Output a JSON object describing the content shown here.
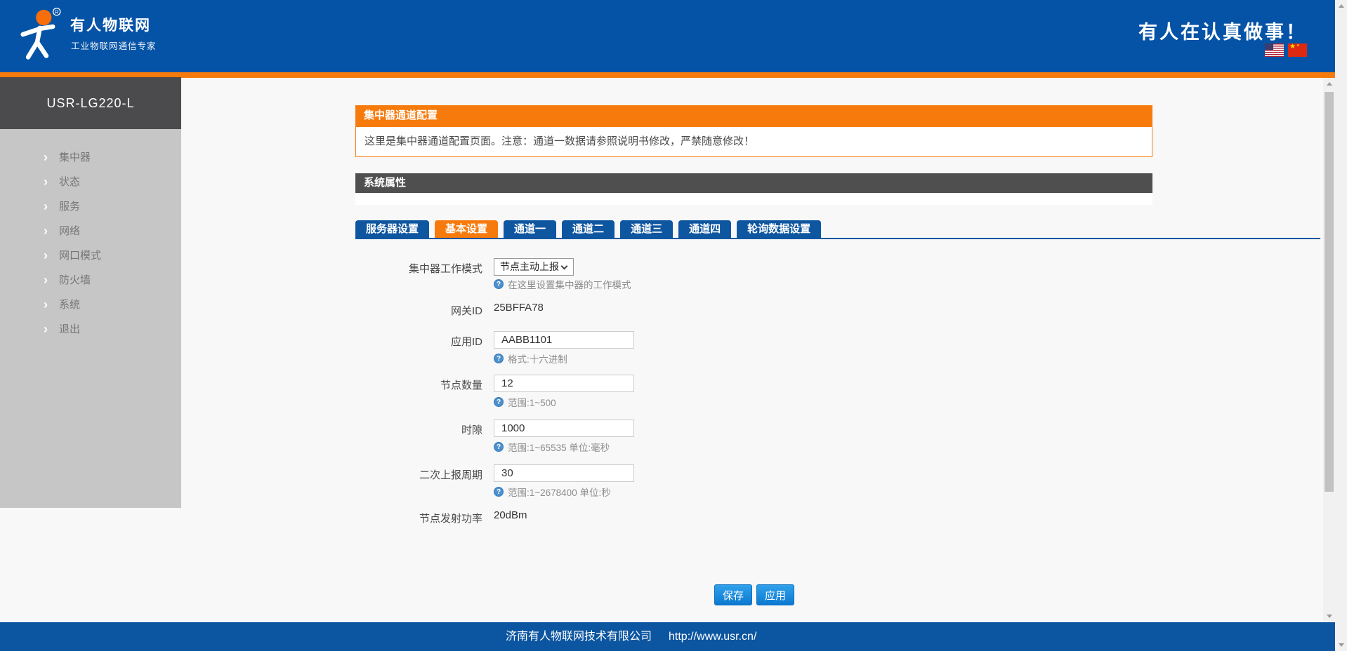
{
  "header": {
    "brand": "有人物联网",
    "tagline": "工业物联网通信专家",
    "reg_mark": "R",
    "slogan": "有人在认真做事！"
  },
  "sidebar": {
    "model": "USR-LG220-L",
    "chevron": "›",
    "items": [
      {
        "label": "集中器"
      },
      {
        "label": "状态"
      },
      {
        "label": "服务"
      },
      {
        "label": "网络"
      },
      {
        "label": "网口模式"
      },
      {
        "label": "防火墙"
      },
      {
        "label": "系统"
      },
      {
        "label": "退出"
      }
    ]
  },
  "main": {
    "page_title": "集中器通道配置",
    "notice": "这里是集中器通道配置页面。注意：通道一数据请参照说明书修改，严禁随意修改！",
    "section_title": "系统属性",
    "tabs": [
      {
        "label": "服务器设置",
        "active": false
      },
      {
        "label": "基本设置",
        "active": true
      },
      {
        "label": "通道一",
        "active": false
      },
      {
        "label": "通道二",
        "active": false
      },
      {
        "label": "通道三",
        "active": false
      },
      {
        "label": "通道四",
        "active": false
      },
      {
        "label": "轮询数据设置",
        "active": false
      }
    ],
    "form": {
      "work_mode": {
        "label": "集中器工作模式",
        "value": "节点主动上报",
        "help": "在这里设置集中器的工作模式"
      },
      "gateway_id": {
        "label": "网关ID",
        "value": "25BFFA78"
      },
      "app_id": {
        "label": "应用ID",
        "value": "AABB1101",
        "help": "格式:十六进制"
      },
      "node_count": {
        "label": "节点数量",
        "value": "12",
        "help": "范围:1~500"
      },
      "time_slot": {
        "label": "时隙",
        "value": "1000",
        "help": "范围:1~65535 单位:毫秒"
      },
      "second_report_period": {
        "label": "二次上报周期",
        "value": "30",
        "help": "范围:1~2678400 单位:秒"
      },
      "node_tx_power": {
        "label": "节点发射功率",
        "value": "20dBm"
      }
    },
    "buttons": {
      "save": "保存",
      "apply": "应用"
    }
  },
  "footer": {
    "company": "济南有人物联网技术有限公司",
    "url": "http://www.usr.cn/"
  },
  "colors": {
    "header_blue": "#0553A6",
    "accent_orange": "#F77B0C",
    "tab_blue": "#0F56A0",
    "section_gray": "#4F4F4F",
    "sidebar_gray": "#C6C6C6",
    "footer_blue": "#0C55A0",
    "button_blue": "#0C79D1"
  }
}
